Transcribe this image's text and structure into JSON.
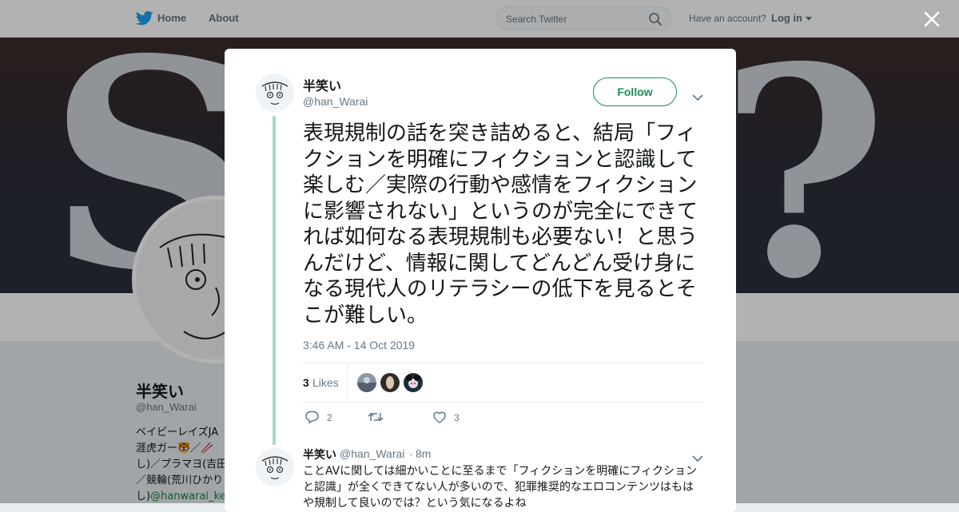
{
  "nav": {
    "logo_icon": "twitter-bird-icon",
    "home_label": "Home",
    "about_label": "About",
    "search_placeholder": "Search Twitter",
    "account_prompt": "Have an account?",
    "login_label": "Log in"
  },
  "colors": {
    "brand_blue": "#1da1f2",
    "accent_green": "#1f8a52",
    "thread_line": "#a6dcc2",
    "muted_text": "#657786"
  },
  "profile": {
    "banner_glyphs": "S?",
    "name": "半笑い",
    "handle": "@han_Warai",
    "bio_lines": "ベイビーレイズJA\n涯虎ガー🐯／🥢\nし)／プラマヨ(吉田\n／競輪(荒川ひかり",
    "bio_link_prefix": "し)",
    "bio_link": "@hanwarai_ke"
  },
  "tweet": {
    "author_name": "半笑い",
    "author_handle": "@han_Warai",
    "follow_label": "Follow",
    "text": "表現規制の話を突き詰めると、結局「フィクションを明確にフィクションと認識して楽しむ／実際の行動や感情をフィクションに影響されない」というのが完全にできてれば如何なる表現規制も必要ない！と思うんだけど、情報に関してどんどん受け身になる現代人のリテラシーの低下を見るとそこが難しい。",
    "timestamp": "3:46 AM - 14 Oct 2019",
    "likes_count": "3",
    "likes_label": "Likes",
    "reply_count": "2",
    "retweet_count": "",
    "like_count": "3"
  },
  "reply": {
    "author_name": "半笑い",
    "author_handle": "@han_Warai",
    "separator": "·",
    "time": "8m",
    "text": "ことAVに関しては細かいことに至るまで「フィクションを明確にフィクションと認識」が全くできてない人が多いので、犯罪推奨的なエロコンテンツはもはや規制して良いのでは？という気になるよね"
  }
}
